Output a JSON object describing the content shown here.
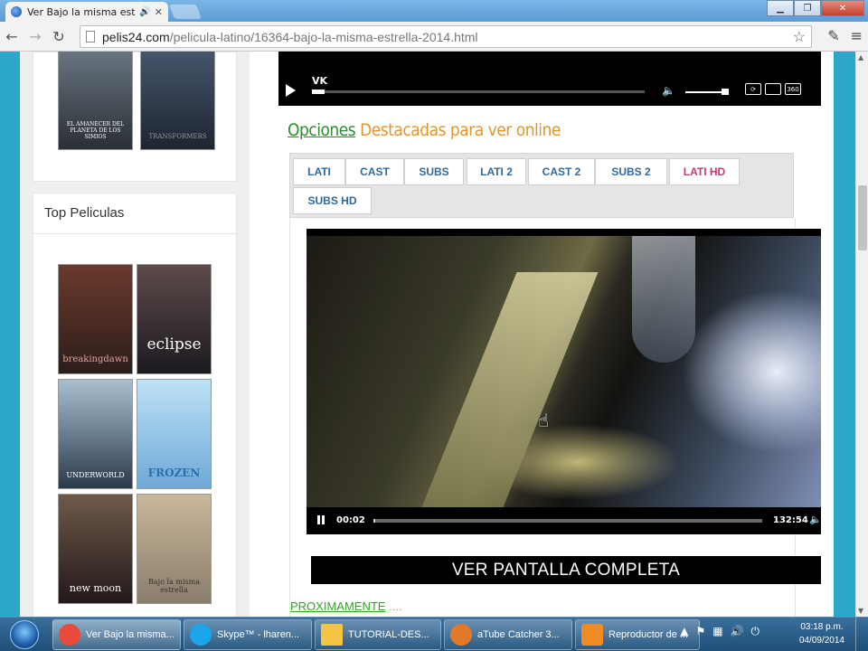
{
  "browser": {
    "tab_title": "Ver Bajo la misma estre",
    "url_host": "pelis24.com",
    "url_path": "/pelicula-latino/16364-bajo-la-misma-estrella-2014.html"
  },
  "vk_player": {
    "label": "VK"
  },
  "options": {
    "heading_a": "Opciones",
    "heading_b": "Destacadas para ver online"
  },
  "tabs": [
    {
      "label": "LATI",
      "active": false
    },
    {
      "label": "CAST",
      "active": false
    },
    {
      "label": "SUBS",
      "active": false
    },
    {
      "label": "LATI 2",
      "active": false
    },
    {
      "label": "CAST 2",
      "active": false
    },
    {
      "label": "SUBS 2",
      "active": false
    },
    {
      "label": "LATI HD",
      "active": true
    },
    {
      "label": "SUBS HD",
      "active": false
    }
  ],
  "video": {
    "current_time": "00:02",
    "total_time": "132:54",
    "progress_fraction": 0.004
  },
  "fullscreen_label": "VER PANTALLA COMPLETA",
  "proximamente": {
    "label": "PROXIMAMENTE",
    "dots": "...."
  },
  "sidebar": {
    "top_title": "Top Peliculas",
    "top_posters": [
      {
        "title": "breakingdawn"
      },
      {
        "title": "eclipse"
      },
      {
        "title": "UNDERWORLD"
      },
      {
        "title": "FROZEN"
      },
      {
        "title": "new moon"
      },
      {
        "title": "Bajo la misma estrella"
      }
    ],
    "upper_posters": [
      {
        "title": "EL AMANECER DEL PLANETA DE LOS SIMIOS"
      },
      {
        "title": "TRANSFORMERS"
      }
    ]
  },
  "taskbar": {
    "items": [
      {
        "label": "Ver Bajo la misma...",
        "color": "#e84b3c"
      },
      {
        "label": "Skype™ - lharen...",
        "color": "#1aa6e8"
      },
      {
        "label": "TUTORIAL-DES...",
        "color": "#f4c542"
      },
      {
        "label": "aTube Catcher 3...",
        "color": "#e07a2a"
      },
      {
        "label": "Reproductor de ...",
        "color": "#f08a24"
      }
    ],
    "time": "03:18 p.m.",
    "date": "04/09/2014"
  }
}
